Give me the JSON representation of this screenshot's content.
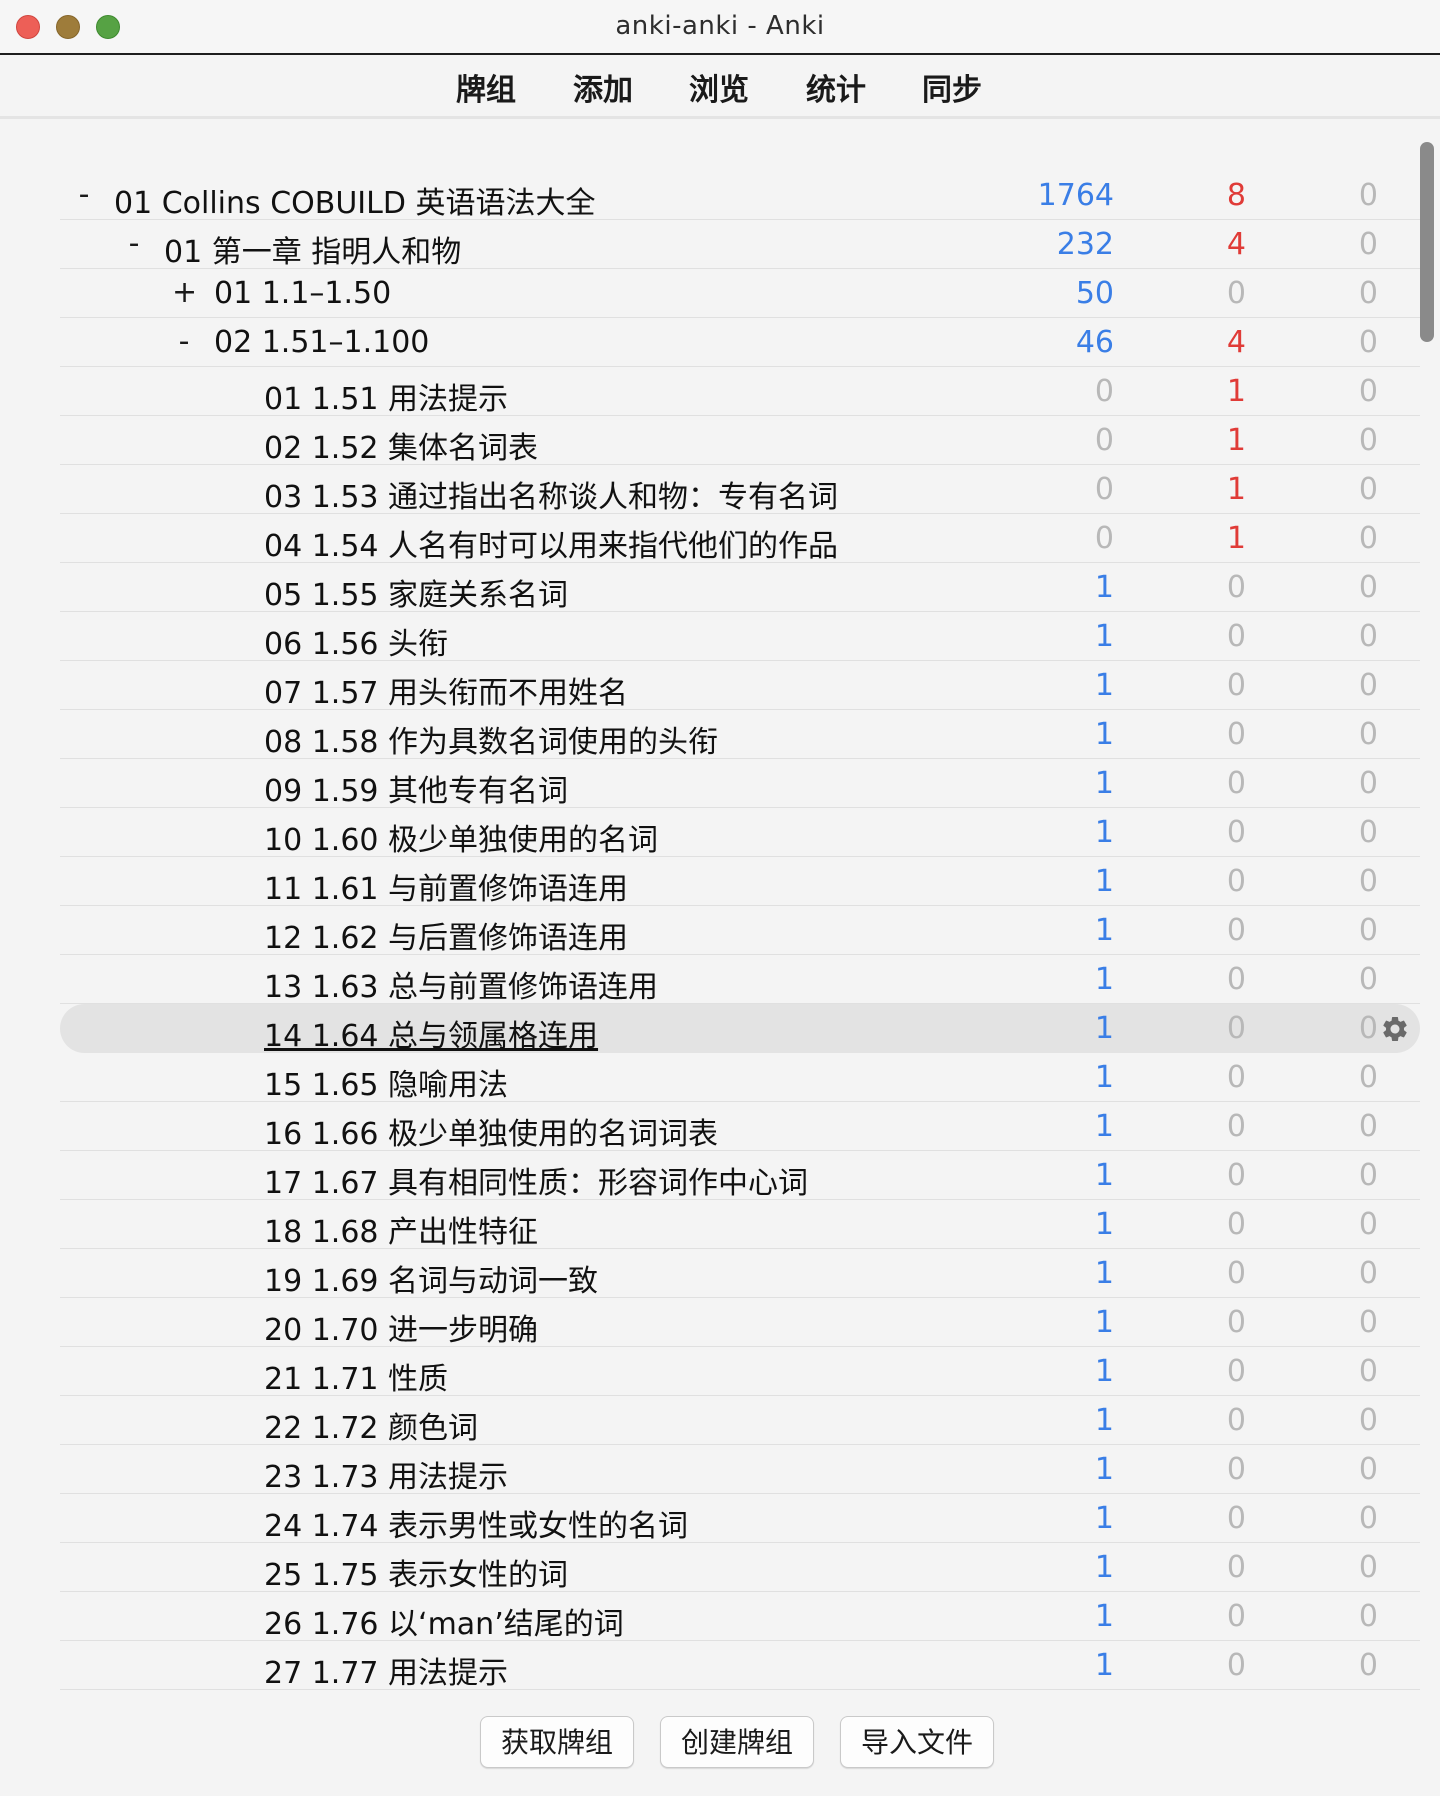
{
  "window": {
    "title": "anki-anki - Anki"
  },
  "toolbar": {
    "items": [
      "牌组",
      "添加",
      "浏览",
      "统计",
      "同步"
    ]
  },
  "colors": {
    "new": "#3a7ee6",
    "learn": "#e03b37",
    "zero": "#b8b8b8",
    "accent_highlight": "#e3e3e3"
  },
  "decks": [
    {
      "expander": "-",
      "name": "01 Collins COBUILD 英语语法大全",
      "level": 0,
      "new": "1764",
      "learn": "8",
      "due": "0"
    },
    {
      "expander": "-",
      "name": "01 第一章 指明人和物",
      "level": 1,
      "new": "232",
      "learn": "4",
      "due": "0"
    },
    {
      "expander": "+",
      "name": "01 1.1–1.50",
      "level": 2,
      "new": "50",
      "learn": "0",
      "due": "0"
    },
    {
      "expander": "-",
      "name": "02 1.51–1.100",
      "level": 2,
      "new": "46",
      "learn": "4",
      "due": "0"
    },
    {
      "expander": "",
      "name": "01 1.51 用法提示",
      "level": 3,
      "new": "0",
      "learn": "1",
      "due": "0"
    },
    {
      "expander": "",
      "name": "02 1.52 集体名词表",
      "level": 3,
      "new": "0",
      "learn": "1",
      "due": "0"
    },
    {
      "expander": "",
      "name": "03 1.53 通过指出名称谈人和物：专有名词",
      "level": 3,
      "new": "0",
      "learn": "1",
      "due": "0"
    },
    {
      "expander": "",
      "name": "04 1.54 人名有时可以用来指代他们的作品",
      "level": 3,
      "new": "0",
      "learn": "1",
      "due": "0"
    },
    {
      "expander": "",
      "name": "05 1.55 家庭关系名词",
      "level": 3,
      "new": "1",
      "learn": "0",
      "due": "0"
    },
    {
      "expander": "",
      "name": "06 1.56 头衔",
      "level": 3,
      "new": "1",
      "learn": "0",
      "due": "0"
    },
    {
      "expander": "",
      "name": "07 1.57 用头衔而不用姓名",
      "level": 3,
      "new": "1",
      "learn": "0",
      "due": "0"
    },
    {
      "expander": "",
      "name": "08 1.58 作为具数名词使用的头衔",
      "level": 3,
      "new": "1",
      "learn": "0",
      "due": "0"
    },
    {
      "expander": "",
      "name": "09 1.59 其他专有名词",
      "level": 3,
      "new": "1",
      "learn": "0",
      "due": "0"
    },
    {
      "expander": "",
      "name": "10 1.60 极少单独使用的名词",
      "level": 3,
      "new": "1",
      "learn": "0",
      "due": "0"
    },
    {
      "expander": "",
      "name": "11 1.61 与前置修饰语连用",
      "level": 3,
      "new": "1",
      "learn": "0",
      "due": "0"
    },
    {
      "expander": "",
      "name": "12 1.62 与后置修饰语连用",
      "level": 3,
      "new": "1",
      "learn": "0",
      "due": "0"
    },
    {
      "expander": "",
      "name": "13 1.63 总与前置修饰语连用",
      "level": 3,
      "new": "1",
      "learn": "0",
      "due": "0"
    },
    {
      "expander": "",
      "name": "14 1.64 总与领属格连用",
      "level": 3,
      "new": "1",
      "learn": "0",
      "due": "0",
      "current": true
    },
    {
      "expander": "",
      "name": "15 1.65 隐喻用法",
      "level": 3,
      "new": "1",
      "learn": "0",
      "due": "0"
    },
    {
      "expander": "",
      "name": "16 1.66 极少单独使用的名词词表",
      "level": 3,
      "new": "1",
      "learn": "0",
      "due": "0"
    },
    {
      "expander": "",
      "name": "17 1.67 具有相同性质：形容词作中心词",
      "level": 3,
      "new": "1",
      "learn": "0",
      "due": "0"
    },
    {
      "expander": "",
      "name": "18 1.68 产出性特征",
      "level": 3,
      "new": "1",
      "learn": "0",
      "due": "0"
    },
    {
      "expander": "",
      "name": "19 1.69 名词与动词一致",
      "level": 3,
      "new": "1",
      "learn": "0",
      "due": "0"
    },
    {
      "expander": "",
      "name": "20 1.70 进一步明确",
      "level": 3,
      "new": "1",
      "learn": "0",
      "due": "0"
    },
    {
      "expander": "",
      "name": "21 1.71 性质",
      "level": 3,
      "new": "1",
      "learn": "0",
      "due": "0"
    },
    {
      "expander": "",
      "name": "22 1.72 颜色词",
      "level": 3,
      "new": "1",
      "learn": "0",
      "due": "0"
    },
    {
      "expander": "",
      "name": "23 1.73 用法提示",
      "level": 3,
      "new": "1",
      "learn": "0",
      "due": "0"
    },
    {
      "expander": "",
      "name": "24 1.74 表示男性或女性的名词",
      "level": 3,
      "new": "1",
      "learn": "0",
      "due": "0"
    },
    {
      "expander": "",
      "name": "25 1.75 表示女性的词",
      "level": 3,
      "new": "1",
      "learn": "0",
      "due": "0"
    },
    {
      "expander": "",
      "name": "26 1.76 以‘man’结尾的词",
      "level": 3,
      "new": "1",
      "learn": "0",
      "due": "0"
    },
    {
      "expander": "",
      "name": "27 1.77 用法提示",
      "level": 3,
      "new": "1",
      "learn": "0",
      "due": "0"
    }
  ],
  "bottom_buttons": {
    "get_shared": "获取牌组",
    "create_deck": "创建牌组",
    "import_file": "导入文件"
  },
  "icons": {
    "options": "gear-icon"
  }
}
